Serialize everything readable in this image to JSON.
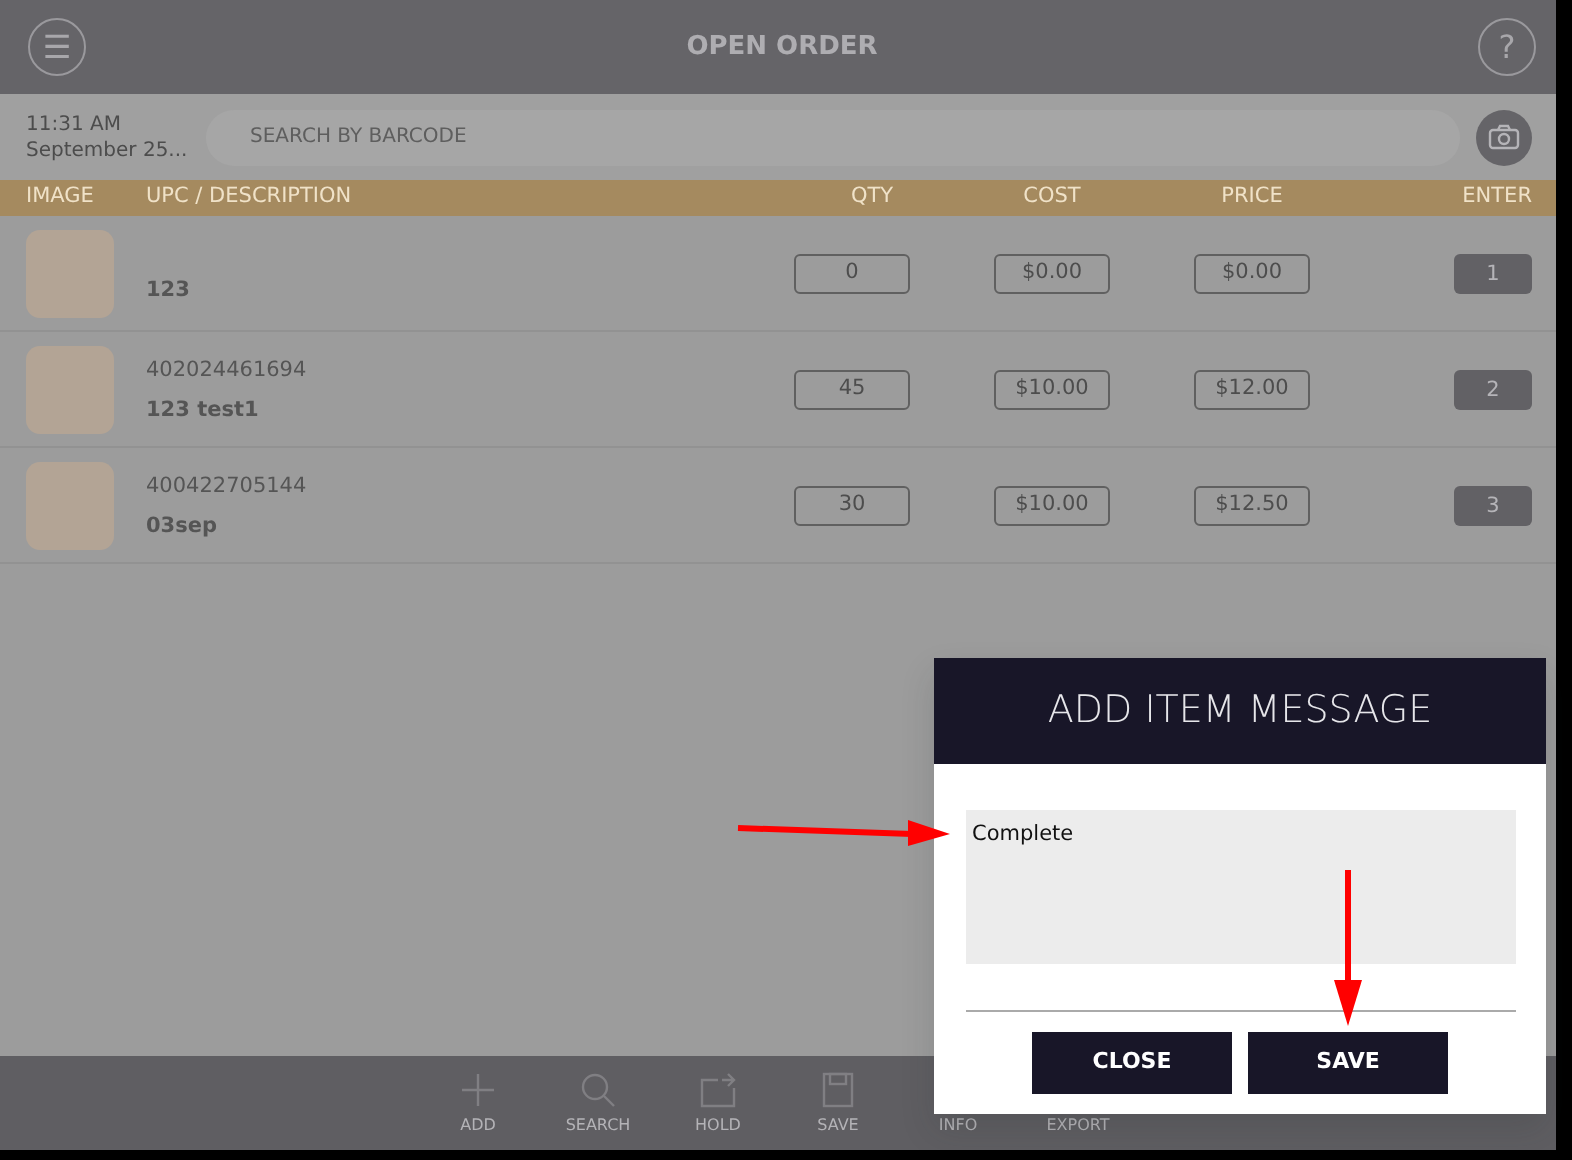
{
  "header": {
    "title": "OPEN ORDER",
    "menu_symbol": "☰",
    "help_symbol": "?"
  },
  "subheader": {
    "time": "11:31 AM",
    "date": "September 25...",
    "search": {
      "placeholder": "SEARCH BY BARCODE"
    }
  },
  "table": {
    "columns": [
      "IMAGE",
      "UPC / DESCRIPTION",
      "QTY",
      "COST",
      "PRICE",
      "ENTER"
    ],
    "rows": [
      {
        "upc": "",
        "description": "123",
        "qty": "0",
        "cost": "$0.00",
        "price": "$0.00",
        "enter": "1"
      },
      {
        "upc": "402024461694",
        "description": "123 test1",
        "qty": "45",
        "cost": "$10.00",
        "price": "$12.00",
        "enter": "2"
      },
      {
        "upc": "400422705144",
        "description": "03sep",
        "qty": "30",
        "cost": "$10.00",
        "price": "$12.50",
        "enter": "3"
      }
    ]
  },
  "toolbar": [
    {
      "label": "ADD",
      "kind": "add"
    },
    {
      "label": "SEARCH",
      "kind": "search"
    },
    {
      "label": "HOLD",
      "kind": "hold"
    },
    {
      "label": "SAVE",
      "kind": "save"
    },
    {
      "label": "INFO",
      "kind": "hidden"
    },
    {
      "label": "EXPORT",
      "kind": "hidden"
    }
  ],
  "dialog": {
    "title": "ADD ITEM MESSAGE",
    "message": "Complete",
    "buttons": [
      "CLOSE",
      "SAVE"
    ]
  }
}
